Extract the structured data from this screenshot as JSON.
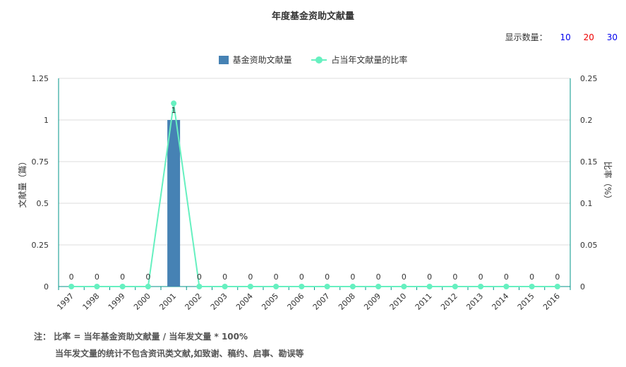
{
  "title": "年度基金资助文献量",
  "display_count": {
    "label": "显示数量：",
    "options": [
      {
        "label": "10",
        "color": "#0000ee"
      },
      {
        "label": "20",
        "color": "#ee0000"
      },
      {
        "label": "30",
        "color": "#0000ee"
      }
    ]
  },
  "legend": {
    "bar_label": "基金资助文献量",
    "line_label": "占当年文献量的比率"
  },
  "notes": {
    "line1": "注：  比率 = 当年基金资助文献量 / 当年发文量 * 100%",
    "line2": "当年发文量的统计不包含资讯类文献,如致谢、稿约、启事、勘误等"
  },
  "chart_data": {
    "type": "bar",
    "categories": [
      "1997",
      "1998",
      "1999",
      "2000",
      "2001",
      "2002",
      "2003",
      "2004",
      "2005",
      "2006",
      "2007",
      "2008",
      "2009",
      "2010",
      "2011",
      "2012",
      "2013",
      "2014",
      "2015",
      "2016"
    ],
    "series": [
      {
        "name": "基金资助文献量",
        "type": "bar",
        "axis": "left",
        "color": "#4682b4",
        "values": [
          0,
          0,
          0,
          0,
          1,
          0,
          0,
          0,
          0,
          0,
          0,
          0,
          0,
          0,
          0,
          0,
          0,
          0,
          0,
          0
        ]
      },
      {
        "name": "占当年文献量的比率",
        "type": "line",
        "axis": "right",
        "color": "#66f0c0",
        "values": [
          0,
          0,
          0,
          0,
          0.22,
          0,
          0,
          0,
          0,
          0,
          0,
          0,
          0,
          0,
          0,
          0,
          0,
          0,
          0,
          0
        ]
      }
    ],
    "data_labels": [
      "0",
      "0",
      "0",
      "0",
      "1",
      "0",
      "0",
      "0",
      "0",
      "0",
      "0",
      "0",
      "0",
      "0",
      "0",
      "0",
      "0",
      "0",
      "0",
      "0"
    ],
    "ylabel": "文献量（篇）",
    "y2label": "比率（%）",
    "ylim": [
      0,
      1.25
    ],
    "y2lim": [
      0,
      0.25
    ],
    "yticks": [
      "0",
      "0.25",
      "0.5",
      "0.75",
      "1",
      "1.25"
    ],
    "y2ticks": [
      "0",
      "0.05",
      "0.1",
      "0.15",
      "0.2",
      "0.25"
    ],
    "grid": true,
    "legend_position": "top-center"
  }
}
